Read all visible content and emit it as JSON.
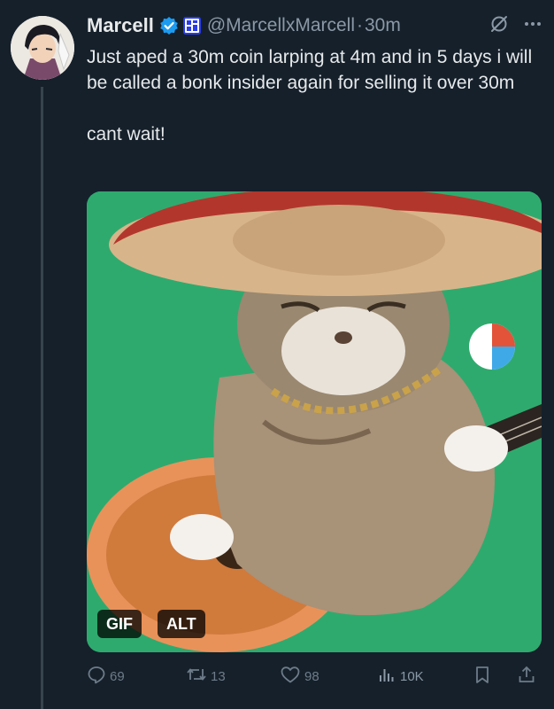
{
  "tweet": {
    "author_name": "Marcell",
    "handle": "@MarcellxMarcell",
    "separator": "·",
    "time": "30m",
    "paragraphs": [
      "Just aped a 30m coin larping at 4m and in 5 days i will be called a bonk insider again for selling it over 30m",
      "cant wait!"
    ]
  },
  "media": {
    "gif_label": "GIF",
    "alt_label": "ALT"
  },
  "actions": {
    "replies": "69",
    "reposts": "13",
    "likes": "98",
    "views": "10K"
  },
  "colors": {
    "background": "#15202b",
    "text": "#e7e9ea",
    "muted": "#8b98a5",
    "action": "#6e7c89",
    "verified": "#1d9bf0",
    "gif_green": "#2faa6e"
  },
  "icons": [
    "verified-badge-icon",
    "affiliate-badge-icon",
    "grok-icon",
    "more-icon",
    "reply-icon",
    "repost-icon",
    "like-icon",
    "views-icon",
    "bookmark-icon",
    "share-icon"
  ]
}
